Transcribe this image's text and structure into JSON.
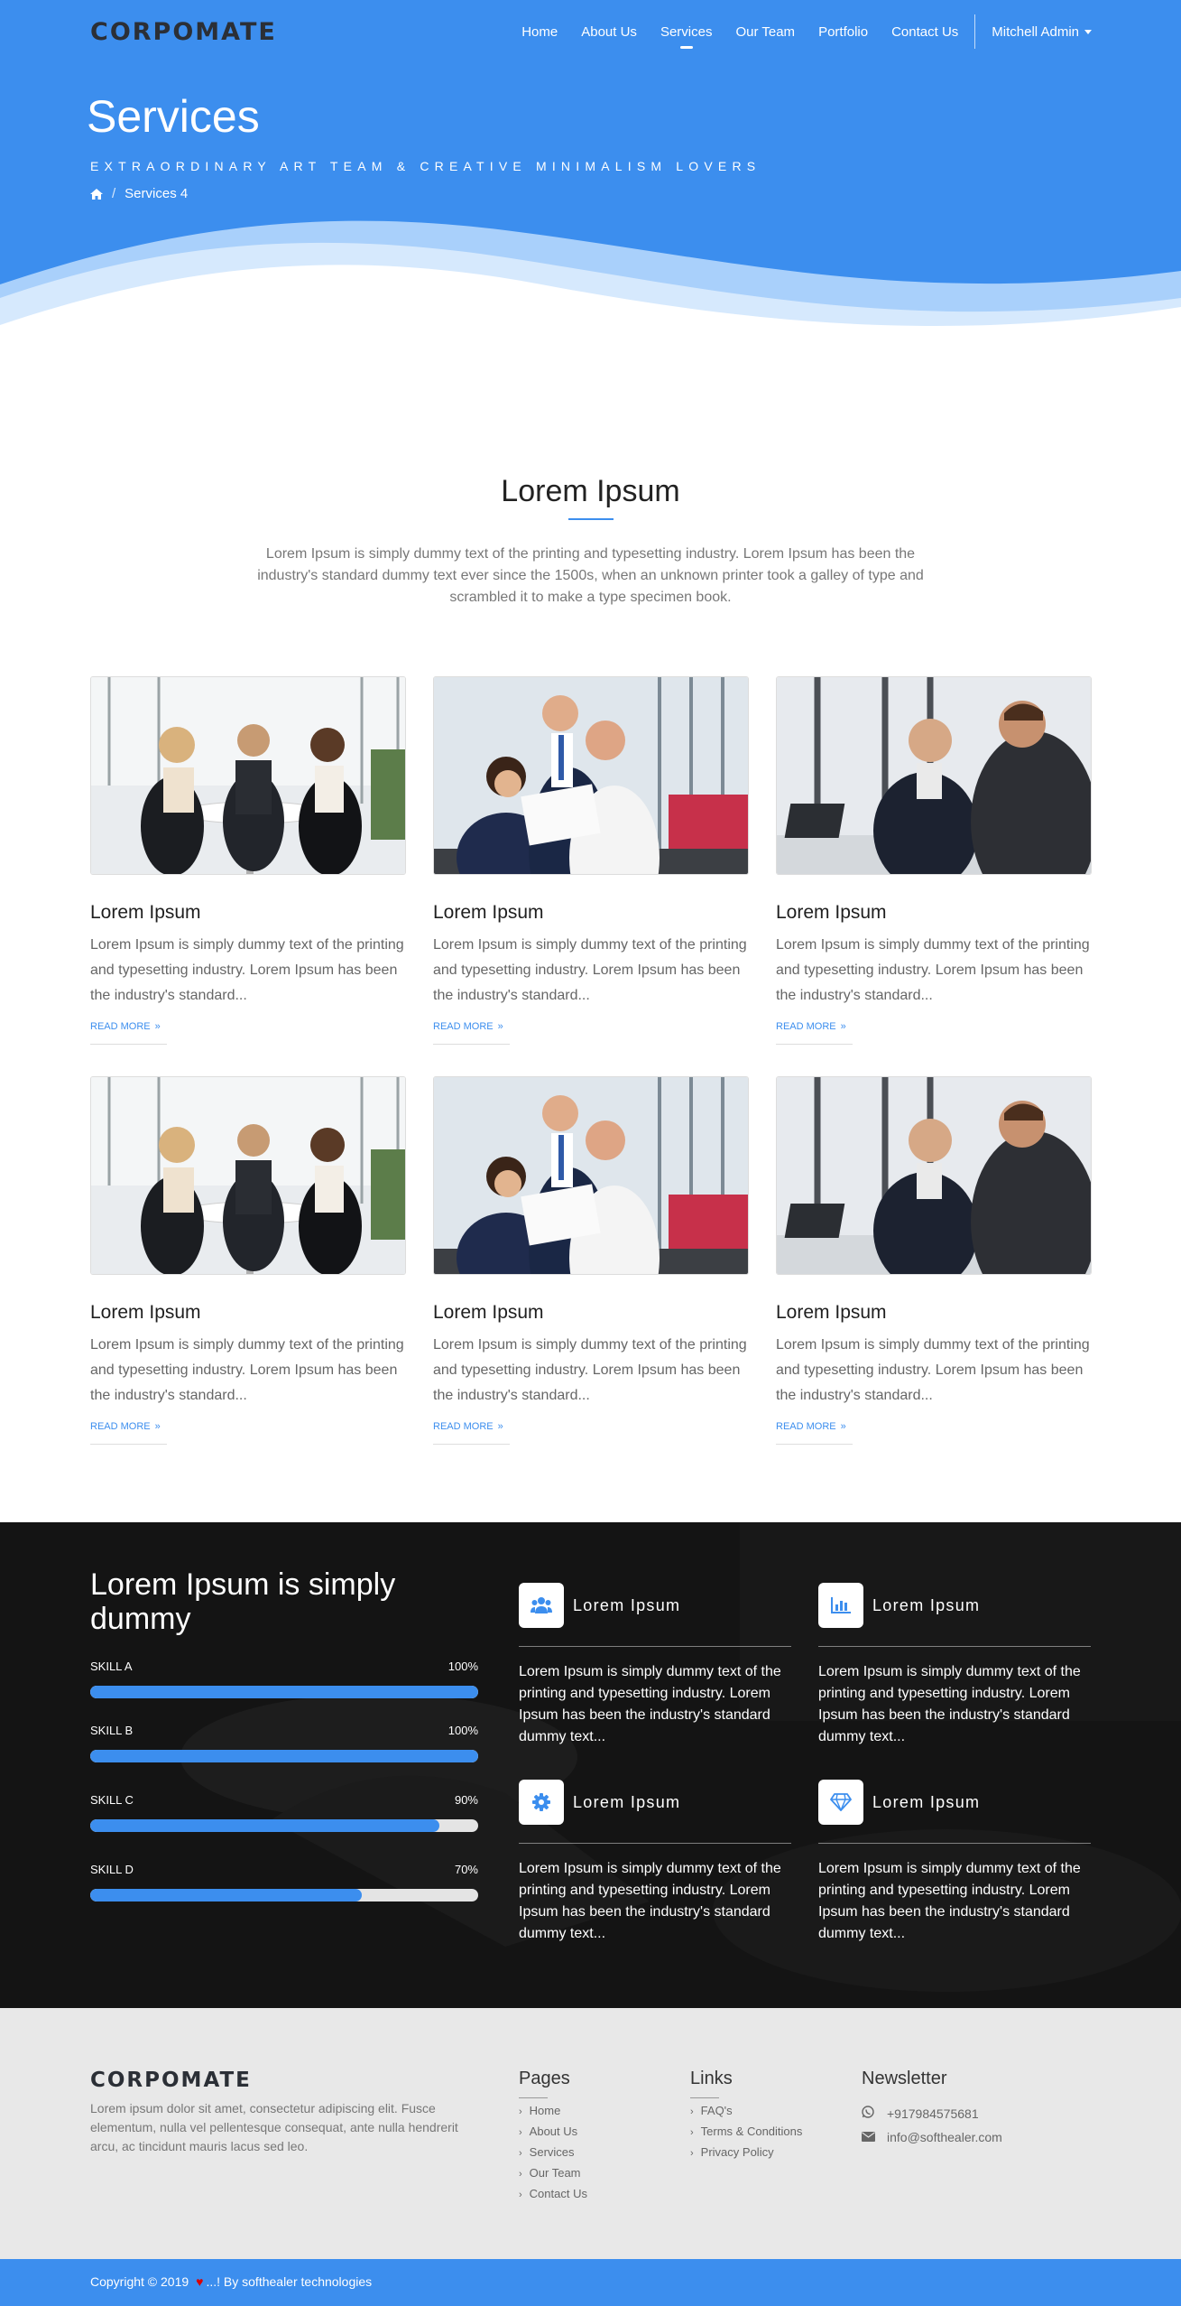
{
  "brand": {
    "logo": "CORPOMATE",
    "accent": "#3c8eee"
  },
  "nav": {
    "items": [
      {
        "label": "Home",
        "active": false
      },
      {
        "label": "About Us",
        "active": false
      },
      {
        "label": "Services",
        "active": true
      },
      {
        "label": "Our Team",
        "active": false
      },
      {
        "label": "Portfolio",
        "active": false
      },
      {
        "label": "Contact Us",
        "active": false
      }
    ],
    "user": "Mitchell Admin"
  },
  "hero": {
    "title": "Services",
    "subtitle": "EXTRAORDINARY ART TEAM & CREATIVE MINIMALISM LOVERS",
    "breadcrumb": {
      "home_icon": "home-icon",
      "separator": "/",
      "current": "Services 4"
    }
  },
  "intro": {
    "title": "Lorem Ipsum",
    "text": "Lorem Ipsum is simply dummy text of the printing and typesetting industry. Lorem Ipsum has been the industry's standard dummy text ever since the 1500s, when an unknown printer took a galley of type and scrambled it to make a type specimen book."
  },
  "cards": [
    {
      "title": "Lorem Ipsum",
      "text": "Lorem Ipsum is simply dummy text of the printing and typesetting industry. Lorem Ipsum has been the industry's standard...",
      "more": "READ MORE",
      "image": "meeting-photo-1"
    },
    {
      "title": "Lorem Ipsum",
      "text": "Lorem Ipsum is simply dummy text of the printing and typesetting industry. Lorem Ipsum has been the industry's standard...",
      "more": "READ MORE",
      "image": "meeting-photo-2"
    },
    {
      "title": "Lorem Ipsum",
      "text": "Lorem Ipsum is simply dummy text of the printing and typesetting industry. Lorem Ipsum has been the industry's standard...",
      "more": "READ MORE",
      "image": "meeting-photo-3"
    },
    {
      "title": "Lorem Ipsum",
      "text": "Lorem Ipsum is simply dummy text of the printing and typesetting industry. Lorem Ipsum has been the industry's standard...",
      "more": "READ MORE",
      "image": "meeting-photo-1"
    },
    {
      "title": "Lorem Ipsum",
      "text": "Lorem Ipsum is simply dummy text of the printing and typesetting industry. Lorem Ipsum has been the industry's standard...",
      "more": "READ MORE",
      "image": "meeting-photo-2"
    },
    {
      "title": "Lorem Ipsum",
      "text": "Lorem Ipsum is simply dummy text of the printing and typesetting industry. Lorem Ipsum has been the industry's standard...",
      "more": "READ MORE",
      "image": "meeting-photo-3"
    }
  ],
  "stats": {
    "title": "Lorem Ipsum is simply dummy",
    "skills": [
      {
        "name": "SKILL A",
        "value": 100,
        "label": "100%"
      },
      {
        "name": "SKILL B",
        "value": 100,
        "label": "100%"
      },
      {
        "name": "SKILL C",
        "value": 90,
        "label": "90%"
      },
      {
        "name": "SKILL D",
        "value": 70,
        "label": "70%"
      }
    ],
    "features": [
      {
        "icon": "users-icon",
        "title": "Lorem Ipsum",
        "text": "Lorem Ipsum is simply dummy text of the printing and typesetting industry. Lorem Ipsum has been the industry's standard dummy text..."
      },
      {
        "icon": "bar-chart-icon",
        "title": "Lorem Ipsum",
        "text": "Lorem Ipsum is simply dummy text of the printing and typesetting industry. Lorem Ipsum has been the industry's standard dummy text..."
      },
      {
        "icon": "gear-icon",
        "title": "Lorem Ipsum",
        "text": "Lorem Ipsum is simply dummy text of the printing and typesetting industry. Lorem Ipsum has been the industry's standard dummy text..."
      },
      {
        "icon": "diamond-icon",
        "title": "Lorem Ipsum",
        "text": "Lorem Ipsum is simply dummy text of the printing and typesetting industry. Lorem Ipsum has been the industry's standard dummy text..."
      }
    ]
  },
  "footer": {
    "logo": "CORPOMATE",
    "about": "Lorem ipsum dolor sit amet, consectetur adipiscing elit. Fusce elementum, nulla vel pellentesque consequat, ante nulla hendrerit arcu, ac tincidunt mauris lacus sed leo.",
    "pages": {
      "title": "Pages",
      "items": [
        "Home",
        "About Us",
        "Services",
        "Our Team",
        "Contact Us"
      ]
    },
    "links": {
      "title": "Links",
      "items": [
        "FAQ's",
        "Terms & Conditions",
        "Privacy Policy"
      ]
    },
    "newsletter": {
      "title": "Newsletter",
      "phone": "+917984575681",
      "email": "info@softhealer.com"
    },
    "copyright_pre": "Copyright © 2019",
    "copyright_post": "...! By softhealer technologies"
  }
}
